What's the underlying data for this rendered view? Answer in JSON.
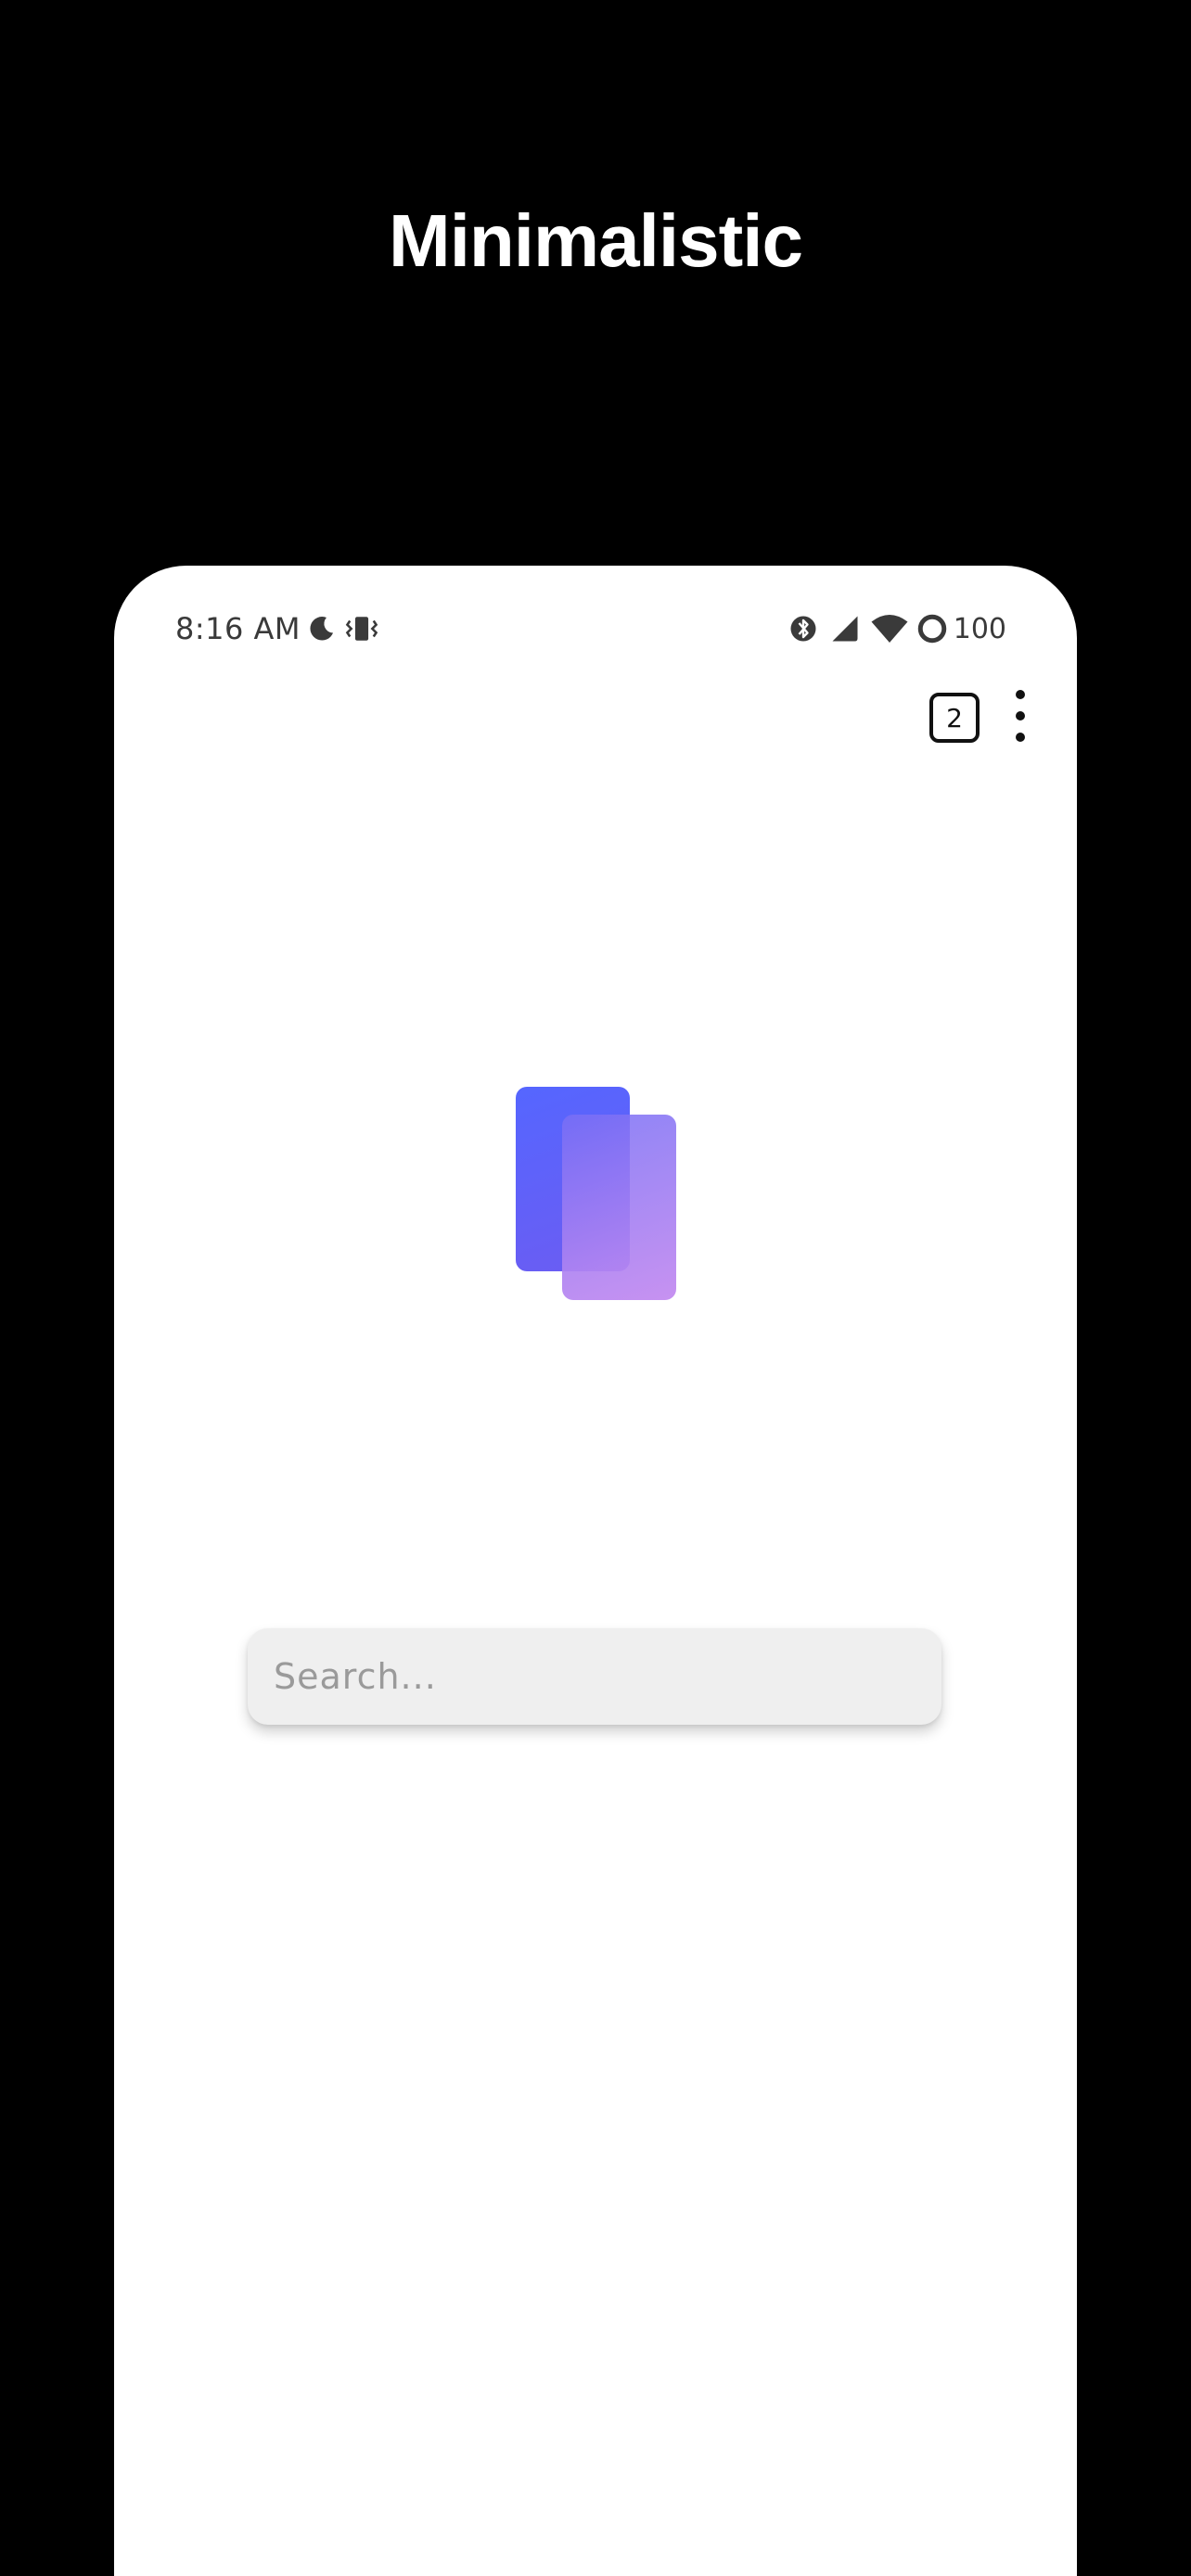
{
  "headline": "Minimalistic",
  "status_bar": {
    "time": "8:16 AM",
    "battery_level": "100",
    "icons_left": [
      "moon-icon",
      "vibrate-icon"
    ],
    "icons_right": [
      "bluetooth-icon",
      "cellular-signal-icon",
      "wifi-icon",
      "battery-icon"
    ]
  },
  "toolbar": {
    "tab_count": "2",
    "menu_icon": "more-vert-icon"
  },
  "logo": {
    "icon": "app-logo-cards",
    "colors": [
      "#5566ff",
      "#c48cf0"
    ]
  },
  "search": {
    "value": "",
    "placeholder": "Search..."
  }
}
